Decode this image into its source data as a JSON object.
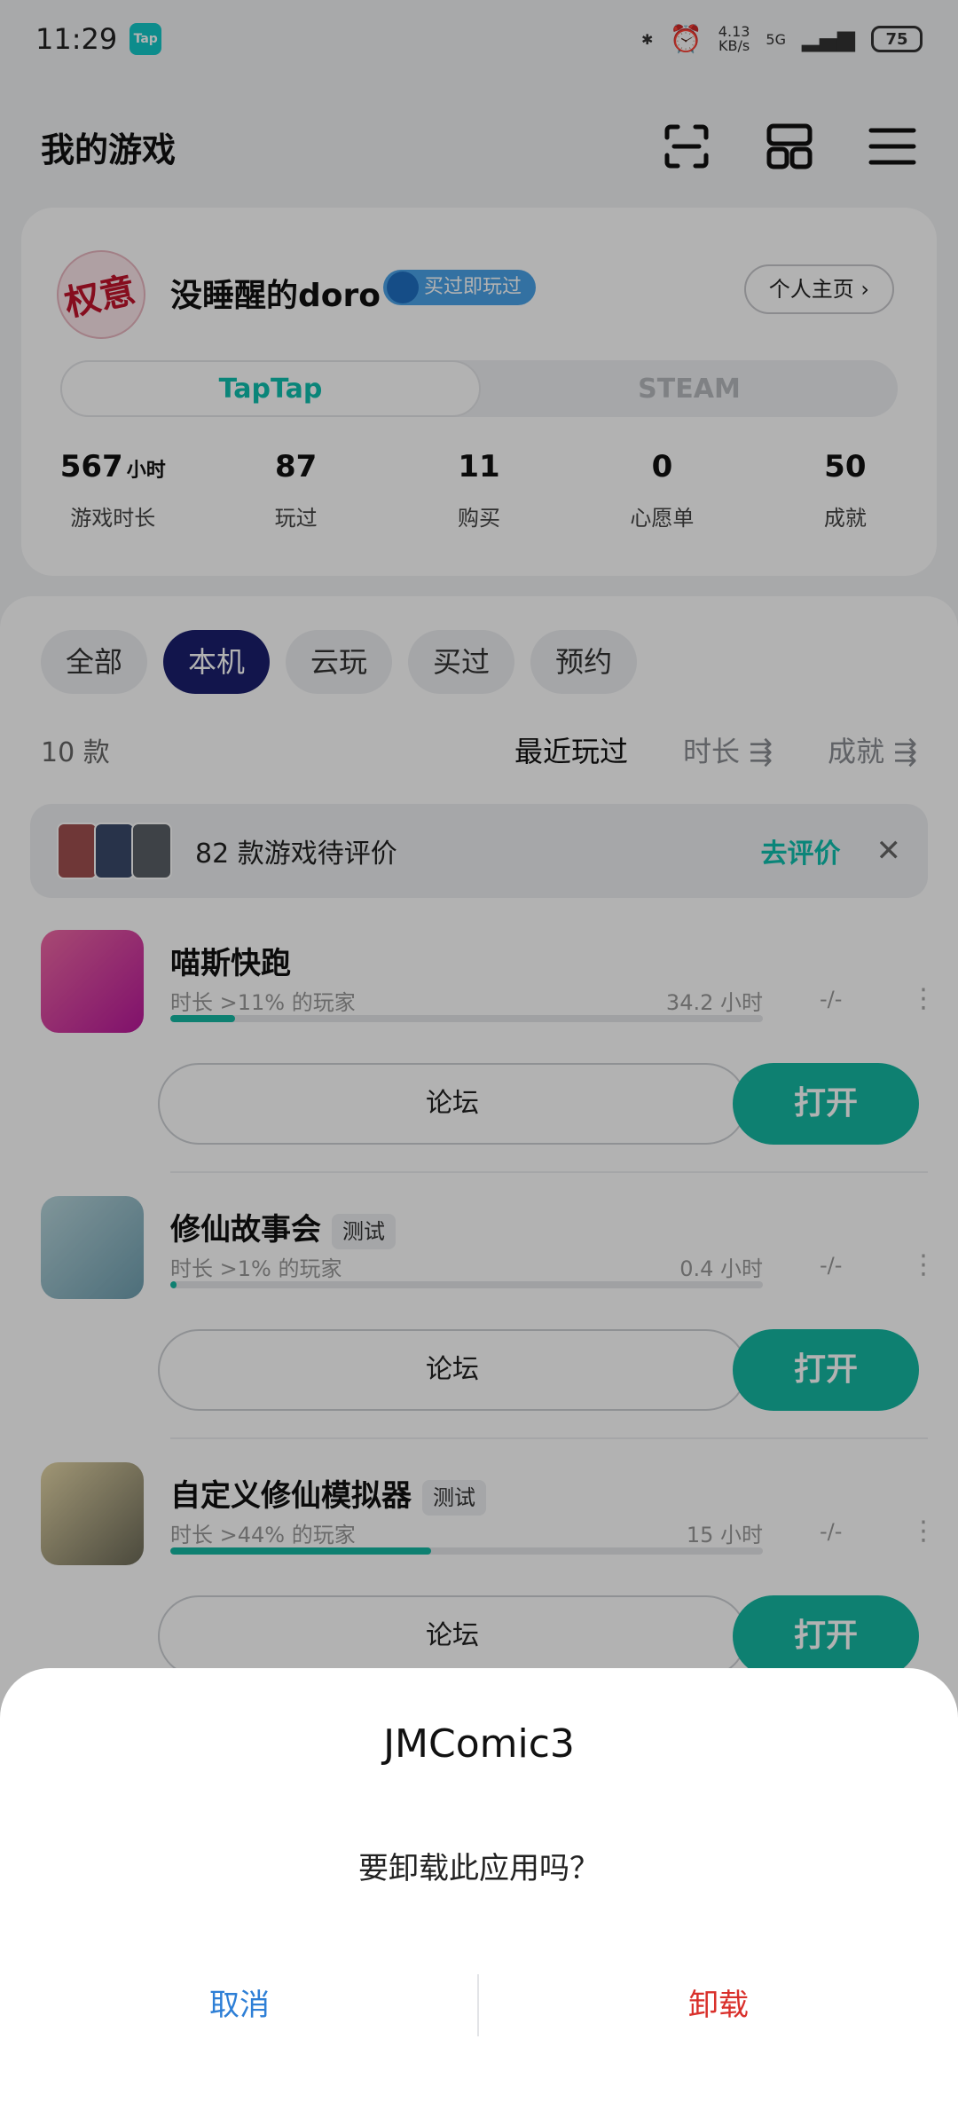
{
  "status_bar": {
    "time": "11:29",
    "app_badge": "Tap",
    "net_speed": "4.13\nKB/s",
    "network": "5G",
    "battery": "75"
  },
  "header": {
    "title": "我的游戏"
  },
  "profile": {
    "avatar_text": "权意",
    "username": "没睡醒的doro",
    "badge": "买过即玩过",
    "home_button": "个人主页 ›",
    "platforms": [
      {
        "label": "TapTap"
      },
      {
        "label": "STEAM"
      }
    ],
    "stats": [
      {
        "value": "567",
        "unit": "小时",
        "label": "游戏时长"
      },
      {
        "value": "87",
        "unit": "",
        "label": "玩过"
      },
      {
        "value": "11",
        "unit": "",
        "label": "购买"
      },
      {
        "value": "0",
        "unit": "",
        "label": "心愿单"
      },
      {
        "value": "50",
        "unit": "",
        "label": "成就"
      }
    ]
  },
  "filters": [
    "全部",
    "本机",
    "云玩",
    "买过",
    "预约"
  ],
  "count": "10 款",
  "sorts": [
    "最近玩过",
    "时长 ⇶",
    "成就 ⇶"
  ],
  "review_banner": {
    "text": "82 款游戏待评价",
    "action": "去评价",
    "close": "✕"
  },
  "games": [
    {
      "title": "喵斯快跑",
      "tag": "",
      "sub": "时长 >11% 的玩家",
      "hours": "34.2 小时",
      "progress": 0.11,
      "rating": "-/-",
      "forum": "论坛",
      "open": "打开",
      "icon_color": "#e8417f"
    },
    {
      "title": "修仙故事会",
      "tag": "测试",
      "sub": "时长 >1% 的玩家",
      "hours": "0.4 小时",
      "progress": 0.01,
      "rating": "-/-",
      "forum": "论坛",
      "open": "打开",
      "icon_color": "#8fb9c7"
    },
    {
      "title": "自定义修仙模拟器",
      "tag": "测试",
      "sub": "时长 >44% 的玩家",
      "hours": "15 小时",
      "progress": 0.44,
      "rating": "-/-",
      "forum": "论坛",
      "open": "打开",
      "icon_color": "#c7b58a"
    }
  ],
  "dialog": {
    "title": "JMComic3",
    "message": "要卸载此应用吗？",
    "cancel": "取消",
    "confirm": "卸载"
  }
}
